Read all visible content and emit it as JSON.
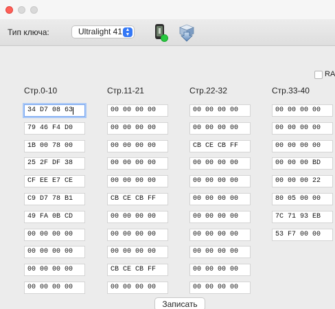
{
  "toolbar": {
    "key_type_label": "Тип ключа:",
    "key_type_value": "Ultralight 41"
  },
  "raw_label": "RAW",
  "columns": [
    {
      "header": "Стр.0-10",
      "cells": [
        "34 D7 08 63",
        "79 46 F4 D0",
        "1B 00 78 00",
        "25 2F DF 38",
        "CF EE E7 CE",
        "C9 D7 78 B1",
        "49 FA 0B CD",
        "00 00 00 00",
        "00 00 00 00",
        "00 00 00 00",
        "00 00 00 00"
      ]
    },
    {
      "header": "Стр.11-21",
      "cells": [
        "00 00 00 00",
        "00 00 00 00",
        "00 00 00 00",
        "00 00 00 00",
        "00 00 00 00",
        "CB CE CB FF",
        "00 00 00 00",
        "00 00 00 00",
        "00 00 00 00",
        "CB CE CB FF",
        "00 00 00 00"
      ]
    },
    {
      "header": "Стр.22-32",
      "cells": [
        "00 00 00 00",
        "00 00 00 00",
        "CB CE CB FF",
        "00 00 00 00",
        "00 00 00 00",
        "00 00 00 00",
        "00 00 00 00",
        "00 00 00 00",
        "00 00 00 00",
        "00 00 00 00",
        "00 00 00 00"
      ]
    },
    {
      "header": "Стр.33-40",
      "cells": [
        "00 00 00 00",
        "00 00 00 00",
        "00 00 00 00",
        "00 00 00 BD",
        "00 00 00 22",
        "80 05 00 00",
        "7C 71 93 EB",
        "53 F7 00 00"
      ]
    }
  ],
  "write_button": "Записать"
}
